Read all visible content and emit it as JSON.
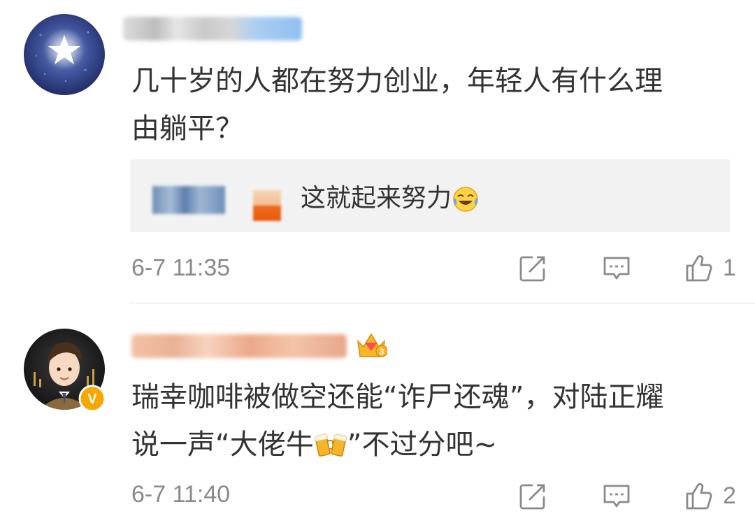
{
  "comments": [
    {
      "text_lines": [
        "几十岁的人都在努力创业，年轻人有什么理",
        "由躺平？"
      ],
      "reply": {
        "text": "这就起来努力"
      },
      "timestamp": "6-7 11:35",
      "likes": "1"
    },
    {
      "text_lines": [
        "瑞幸咖啡被做空还能“诈尸还魂”，对陆正耀",
        "说一声“大佬牛",
        "”不过分吧~"
      ],
      "timestamp": "6-7 11:40",
      "likes": "2",
      "badges": {
        "verified": "V",
        "vip_level": "3"
      }
    }
  ],
  "icons": [
    "share-icon",
    "comment-icon",
    "like-icon",
    "laugh-cry-emoji",
    "beer-cheers-emoji",
    "crown-badge-icon"
  ],
  "colors": {
    "text": "#333333",
    "meta": "#8a8a8a",
    "reply_bg": "#f2f2f2",
    "verified": "#f7a700",
    "divider": "#e6e6e6"
  }
}
